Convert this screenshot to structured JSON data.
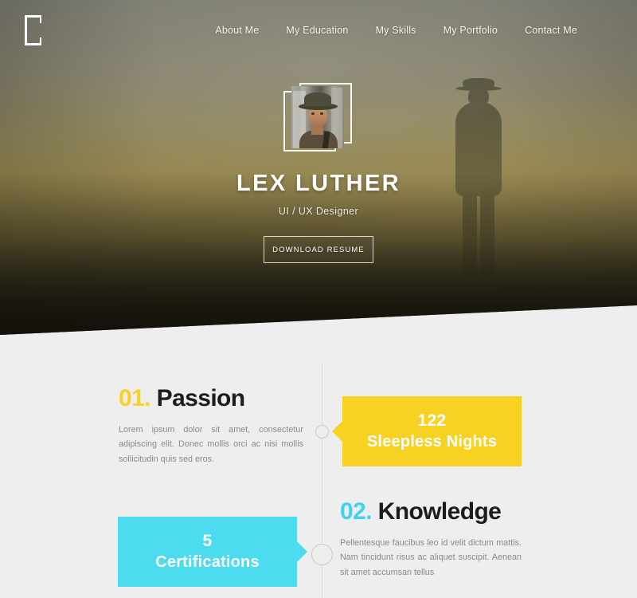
{
  "brand": {
    "logo_icon": "bracket-logo-icon"
  },
  "nav": {
    "items": [
      {
        "label": "About Me"
      },
      {
        "label": "My Education"
      },
      {
        "label": "My Skills"
      },
      {
        "label": "My Portfolio"
      },
      {
        "label": "Contact Me"
      }
    ]
  },
  "hero": {
    "avatar_icon": "portrait-photo",
    "name": "LEX LUTHER",
    "role": "UI / UX Designer",
    "cta_label": "DOWNLOAD RESUME"
  },
  "timeline": {
    "entries": [
      {
        "number": "01.",
        "title": "Passion",
        "number_color": "#f8d223",
        "body": "Lorem ipsum dolor sit amet, consectetur adipiscing elit. Donec mollis orci ac nisi mollis sollicitudin quis sed eros.",
        "stat_value": "122",
        "stat_label": "Sleepless Nights",
        "stat_color": "#f8d223"
      },
      {
        "number": "02.",
        "title": "Knowledge",
        "number_color": "#3fd2f2",
        "body": "Pellentesque faucibus leo id velit dictum mattis. Nam tincidunt risus ac aliquet suscipit. Aenean sit amet accumsan tellus",
        "stat_value": "5",
        "stat_label": "Certifications",
        "stat_color": "#4ddbf0"
      }
    ]
  },
  "theme": {
    "background": "#eeeeee",
    "yellow": "#f8d223",
    "cyan": "#4ddbf0",
    "heading": "#1c1c1c",
    "body_text": "#8a8a8a"
  }
}
